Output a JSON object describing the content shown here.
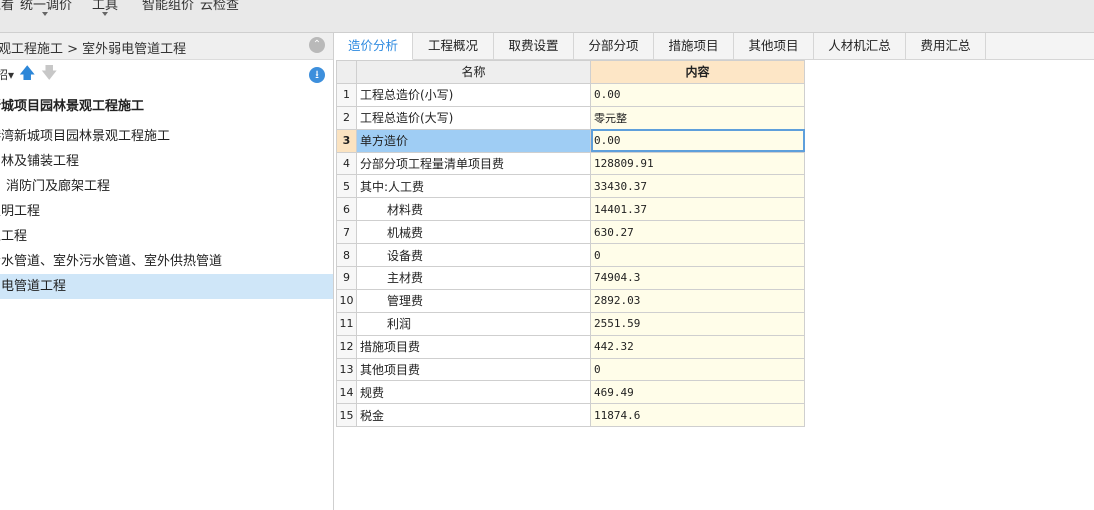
{
  "toolbar": {
    "items": [
      "汇看",
      "统一调价",
      "工具",
      "智能组价",
      "云检查"
    ]
  },
  "left_panel": {
    "breadcrumb": "观工程施工 > 室外弱电管道工程",
    "tools_stub": "招",
    "tree": [
      {
        "label": "新城项目园林景观工程施工",
        "level": "root"
      },
      {
        "label": "港湾新城项目园林景观工程施工",
        "level": "l1"
      },
      {
        "label": "园林及铺装工程",
        "level": "l1"
      },
      {
        "label": "消防门及廊架工程",
        "level": "l2"
      },
      {
        "label": "照明工程",
        "level": "l1"
      },
      {
        "label": "土工程",
        "level": "l1"
      },
      {
        "label": "给水管道、室外污水管道、室外供热管道",
        "level": "l1"
      },
      {
        "label": "弱电管道工程",
        "level": "l1",
        "selected": true
      }
    ]
  },
  "tabs": [
    {
      "label": "造价分析",
      "active": true
    },
    {
      "label": "工程概况"
    },
    {
      "label": "取费设置"
    },
    {
      "label": "分部分项"
    },
    {
      "label": "措施项目"
    },
    {
      "label": "其他项目"
    },
    {
      "label": "人材机汇总"
    },
    {
      "label": "费用汇总"
    }
  ],
  "table": {
    "headers": [
      "名称",
      "内容"
    ],
    "rows": [
      {
        "no": "1",
        "name": "工程总造价(小写)",
        "value": "0.00"
      },
      {
        "no": "2",
        "name": "工程总造价(大写)",
        "value": "零元整"
      },
      {
        "no": "3",
        "name": "单方造价",
        "value": "0.00",
        "selected": true
      },
      {
        "no": "4",
        "name": "分部分项工程量清单项目费",
        "value": "128809.91"
      },
      {
        "no": "5",
        "name": "其中:人工费",
        "value": "33430.37"
      },
      {
        "no": "6",
        "name": "材料费",
        "value": "14401.37",
        "indent": true
      },
      {
        "no": "7",
        "name": "机械费",
        "value": "630.27",
        "indent": true
      },
      {
        "no": "8",
        "name": "设备费",
        "value": "0",
        "indent": true
      },
      {
        "no": "9",
        "name": "主材费",
        "value": "74904.3",
        "indent": true
      },
      {
        "no": "10",
        "name": "管理费",
        "value": "2892.03",
        "indent": true
      },
      {
        "no": "11",
        "name": "利润",
        "value": "2551.59",
        "indent": true
      },
      {
        "no": "12",
        "name": "措施项目费",
        "value": "442.32"
      },
      {
        "no": "13",
        "name": "其他项目费",
        "value": "0"
      },
      {
        "no": "14",
        "name": "规费",
        "value": "469.49"
      },
      {
        "no": "15",
        "name": "税金",
        "value": "11874.6"
      }
    ]
  }
}
